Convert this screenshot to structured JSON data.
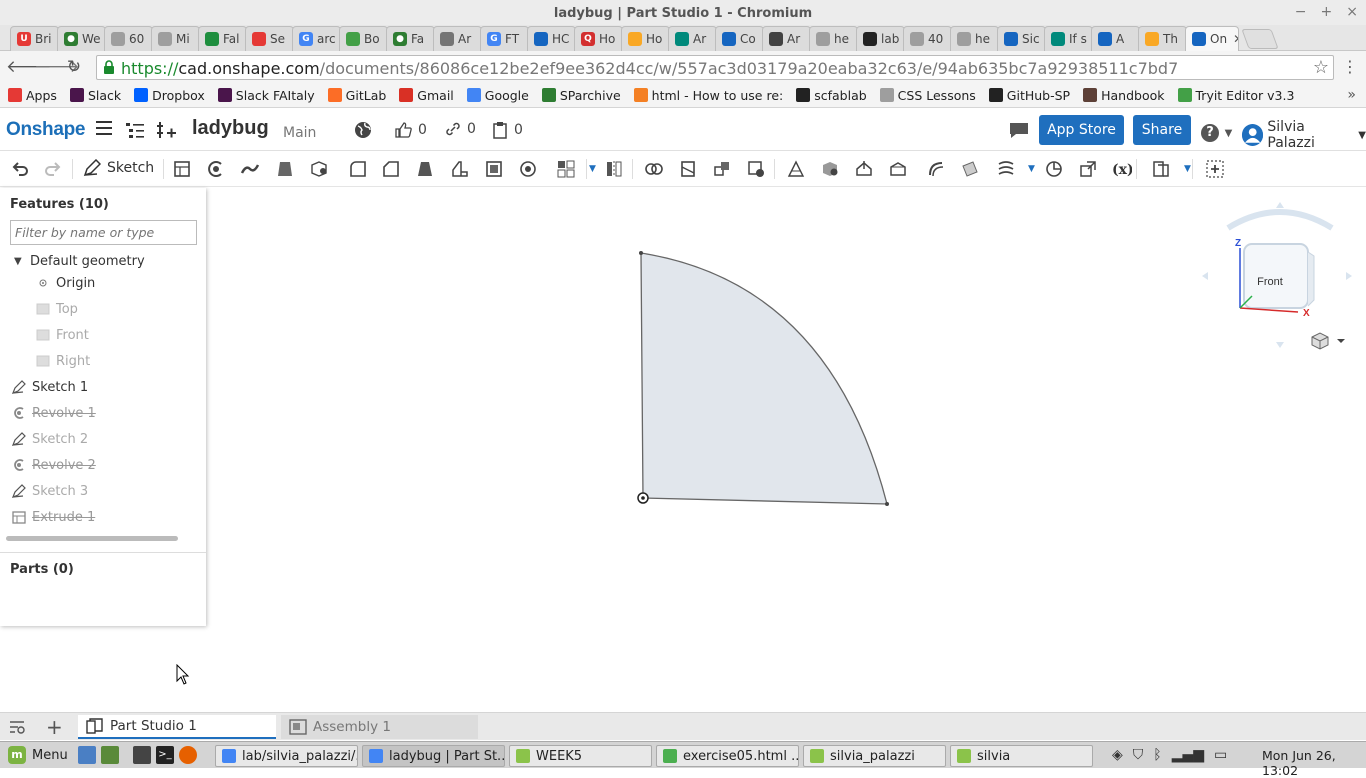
{
  "window": {
    "title": "ladybug | Part Studio 1 - Chromium",
    "controls": [
      "−",
      "+",
      "×"
    ]
  },
  "tabs": [
    {
      "label": "Bri",
      "color": "#e53935",
      "glyph": "U"
    },
    {
      "label": "We",
      "color": "#2e7d32",
      "glyph": "●"
    },
    {
      "label": "60",
      "color": "#9e9e9e",
      "glyph": ""
    },
    {
      "label": "Mi",
      "color": "#9e9e9e",
      "glyph": ""
    },
    {
      "label": "Fal",
      "color": "#1e8e3e",
      "glyph": ""
    },
    {
      "label": "Se",
      "color": "#e53935",
      "glyph": ""
    },
    {
      "label": "arc",
      "color": "#4285f4",
      "glyph": "G"
    },
    {
      "label": "Bo",
      "color": "#43a047",
      "glyph": ""
    },
    {
      "label": "Fa",
      "color": "#2e7d32",
      "glyph": "●"
    },
    {
      "label": "Ar",
      "color": "#757575",
      "glyph": ""
    },
    {
      "label": "FT",
      "color": "#4285f4",
      "glyph": "G"
    },
    {
      "label": "HC",
      "color": "#1565c0",
      "glyph": ""
    },
    {
      "label": "Ho",
      "color": "#d32f2f",
      "glyph": "Q"
    },
    {
      "label": "Ho",
      "color": "#f9a825",
      "glyph": ""
    },
    {
      "label": "Ar",
      "color": "#00897b",
      "glyph": ""
    },
    {
      "label": "Co",
      "color": "#1565c0",
      "glyph": ""
    },
    {
      "label": "Ar",
      "color": "#424242",
      "glyph": ""
    },
    {
      "label": "he",
      "color": "#9e9e9e",
      "glyph": ""
    },
    {
      "label": "lab",
      "color": "#222222",
      "glyph": ""
    },
    {
      "label": "40",
      "color": "#9e9e9e",
      "glyph": ""
    },
    {
      "label": "he",
      "color": "#9e9e9e",
      "glyph": ""
    },
    {
      "label": "Sic",
      "color": "#1565c0",
      "glyph": ""
    },
    {
      "label": "If s",
      "color": "#00897b",
      "glyph": ""
    },
    {
      "label": "A",
      "color": "#1565c0",
      "glyph": ""
    },
    {
      "label": "Th",
      "color": "#f9a825",
      "glyph": ""
    },
    {
      "label": "On",
      "color": "#1565c0",
      "glyph": "",
      "active": true
    }
  ],
  "navbar": {
    "url_scheme": "https://",
    "url_host": "cad.onshape.com",
    "url_path": "/documents/86086ce12be2ef9ee362d4cc/w/557ac3d03179a20eaba32c63/e/94ab635bc7a92938511c7bd7"
  },
  "bookmarks": [
    {
      "label": "Apps",
      "color": "#e53935"
    },
    {
      "label": "Slack",
      "color": "#4a154b"
    },
    {
      "label": "Dropbox",
      "color": "#0061ff"
    },
    {
      "label": "Slack FAItaly",
      "color": "#4a154b"
    },
    {
      "label": "GitLab",
      "color": "#fc6d26"
    },
    {
      "label": "Gmail",
      "color": "#d93025"
    },
    {
      "label": "Google",
      "color": "#4285f4"
    },
    {
      "label": "SParchive",
      "color": "#2e7d32"
    },
    {
      "label": "html - How to use re:",
      "color": "#f48024"
    },
    {
      "label": "scfablab",
      "color": "#222222"
    },
    {
      "label": "CSS Lessons",
      "color": "#9e9e9e"
    },
    {
      "label": "GitHub-SP",
      "color": "#222222"
    },
    {
      "label": "Handbook",
      "color": "#5d4037"
    },
    {
      "label": "Tryit Editor v3.3",
      "color": "#43a047"
    }
  ],
  "header": {
    "logo": "Onshape",
    "doc_title": "ladybug",
    "workspace": "Main",
    "likes": "0",
    "links": "0",
    "copies": "0",
    "app_store": "App Store",
    "share": "Share",
    "help": "?",
    "user": "Silvia Palazzi",
    "accent": "#1f6fbe"
  },
  "toolbar": {
    "sketch_label": "Sketch"
  },
  "features": {
    "title": "Features (10)",
    "filter_placeholder": "Filter by name or type",
    "default_geometry": "Default geometry",
    "items": [
      {
        "label": "Origin",
        "icon": "origin-icon",
        "indent": 2,
        "dim": false,
        "strike": false
      },
      {
        "label": "Top",
        "icon": "plane-icon",
        "indent": 2,
        "dim": true,
        "strike": false
      },
      {
        "label": "Front",
        "icon": "plane-icon",
        "indent": 2,
        "dim": true,
        "strike": false
      },
      {
        "label": "Right",
        "icon": "plane-icon",
        "indent": 2,
        "dim": true,
        "strike": false
      },
      {
        "label": "Sketch 1",
        "icon": "sketch-icon",
        "indent": 0,
        "dim": false,
        "strike": false
      },
      {
        "label": "Revolve 1",
        "icon": "revolve-icon",
        "indent": 0,
        "dim": false,
        "strike": true
      },
      {
        "label": "Sketch 2",
        "icon": "sketch-icon",
        "indent": 0,
        "dim": true,
        "strike": false
      },
      {
        "label": "Revolve 2",
        "icon": "revolve-icon",
        "indent": 0,
        "dim": false,
        "strike": true
      },
      {
        "label": "Sketch 3",
        "icon": "sketch-icon",
        "indent": 0,
        "dim": true,
        "strike": false
      },
      {
        "label": "Extrude 1",
        "icon": "extrude-icon",
        "indent": 0,
        "dim": false,
        "strike": true
      }
    ],
    "parts_title": "Parts (0)"
  },
  "viewcube": {
    "face": "Front",
    "axis_z": "Z",
    "axis_x": "X"
  },
  "bottom_tabs": [
    {
      "label": "Part Studio 1"
    },
    {
      "label": "Assembly 1"
    }
  ],
  "taskbar": {
    "menu": "Menu",
    "tasks": [
      {
        "label": "lab/silvia_palazzi/...",
        "color": "#4285f4"
      },
      {
        "label": "ladybug | Part St...",
        "color": "#4285f4",
        "active": true
      },
      {
        "label": "WEEK5",
        "color": "#8bc34a"
      },
      {
        "label": "exercise05.html ...",
        "color": "#4caf50"
      },
      {
        "label": "silvia_palazzi",
        "color": "#8bc34a"
      },
      {
        "label": "silvia",
        "color": "#8bc34a"
      }
    ],
    "clock": "Mon Jun 26, 13:02"
  }
}
